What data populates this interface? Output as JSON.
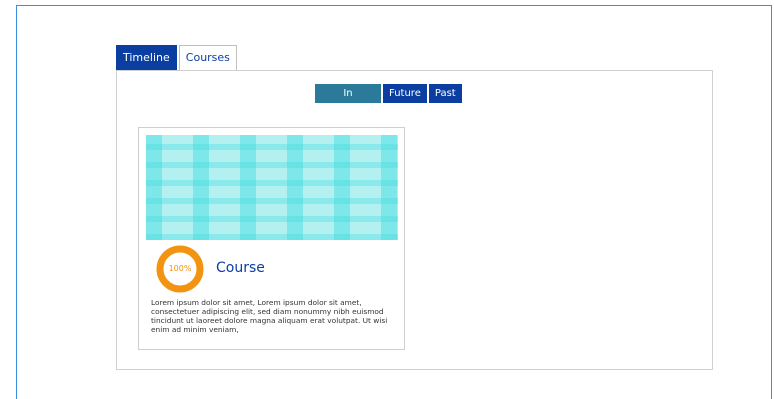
{
  "tabs": [
    {
      "label": "Timeline",
      "active": true
    },
    {
      "label": "Courses",
      "active": false
    }
  ],
  "filters": [
    {
      "label": "In progress",
      "active": true
    },
    {
      "label": "Future",
      "active": false
    },
    {
      "label": "Past",
      "active": false
    }
  ],
  "course": {
    "title": "Course",
    "progress_label": "100%",
    "progress_fraction": 1.0,
    "description": "Lorem ipsum dolor sit amet, Lorem ipsum dolor sit amet, consectetuer adipiscing elit, sed diam nonummy nibh euismod tincidunt ut laoreet dolore magna aliquam erat volutpat. Ut wisi enim ad minim veniam,"
  },
  "colors": {
    "accent": "#0a3ea1",
    "in_progress": "#2c7a9a",
    "progress_ring": "#f29411",
    "frame_border": "#3b8fe0",
    "card_image": "#b4f0f0"
  }
}
